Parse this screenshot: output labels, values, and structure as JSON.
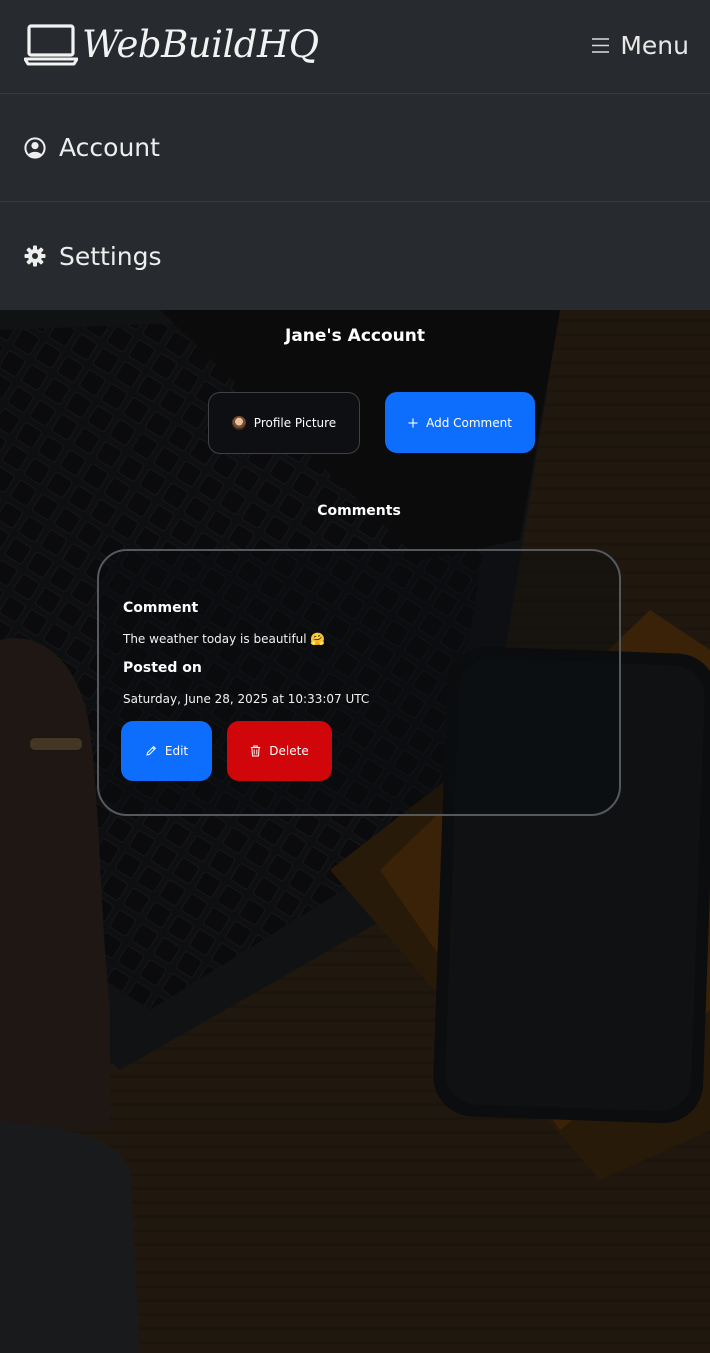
{
  "header": {
    "brand": "WebBuildHQ",
    "menu_label": "Menu"
  },
  "nav": {
    "account_label": "Account",
    "settings_label": "Settings"
  },
  "page": {
    "title": "Jane's Account",
    "profile_button": "Profile Picture",
    "add_comment_button": "Add Comment",
    "comments_heading": "Comments"
  },
  "comment": {
    "comment_label": "Comment",
    "comment_text": "The weather today is beautiful 🤗",
    "posted_label": "Posted on",
    "posted_value": "Saturday, June 28, 2025 at 10:33:07 UTC",
    "edit_button": "Edit",
    "delete_button": "Delete"
  },
  "colors": {
    "navbar_bg": "#272b30",
    "primary": "#0d6efd",
    "danger": "#d0060b"
  }
}
